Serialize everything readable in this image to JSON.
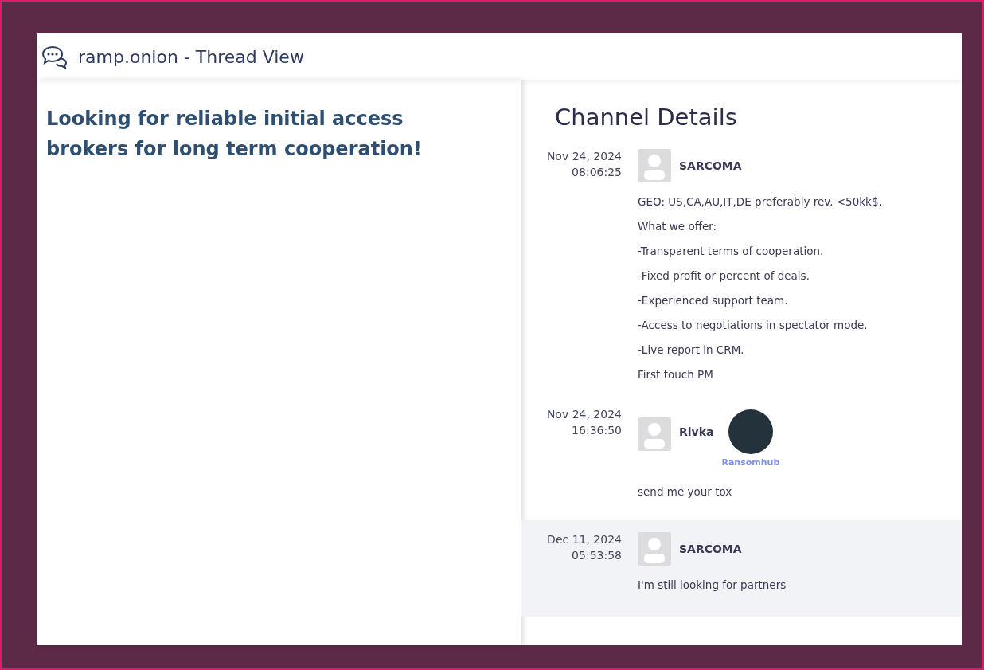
{
  "window": {
    "title": "ramp.onion - Thread View"
  },
  "thread": {
    "title": "Looking for reliable initial access brokers for long term cooperation!"
  },
  "channel": {
    "heading": "Channel Details",
    "messages": [
      {
        "date": "Nov 24, 2024",
        "time": "08:06:25",
        "author": "SARCOMA",
        "highlighted": false,
        "lines": [
          "GEO: US,CA,AU,IT,DE preferably rev. <50kk$.",
          "What we offer:",
          "-Transparent terms of cooperation.",
          "-Fixed profit or percent of deals.",
          "-Experienced support team.",
          "-Access to negotiations in spectator mode.",
          "-Live report in CRM.",
          "First touch PM"
        ]
      },
      {
        "date": "Nov 24, 2024",
        "time": "16:36:50",
        "author": "Rivka",
        "highlighted": false,
        "badge": {
          "label": "Ransomhub"
        },
        "lines": [
          "send me your tox"
        ]
      },
      {
        "date": "Dec 11, 2024",
        "time": "05:53:58",
        "author": "SARCOMA",
        "highlighted": true,
        "lines": [
          "I'm still looking for partners"
        ]
      }
    ]
  }
}
